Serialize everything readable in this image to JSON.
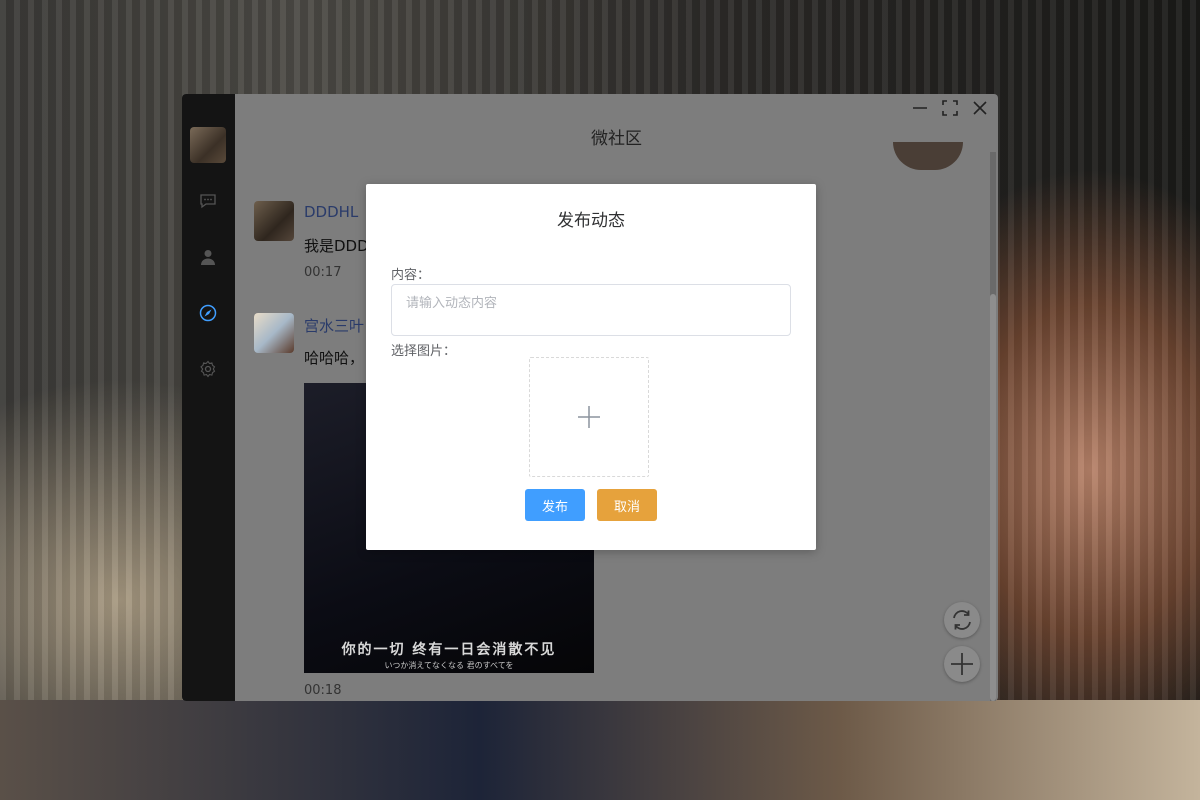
{
  "window": {
    "title": "微社区"
  },
  "sidebar": {
    "icons": [
      "chat-icon",
      "user-icon",
      "compass-icon",
      "gear-icon"
    ]
  },
  "posts": [
    {
      "name": "DDDHL",
      "text": "我是DDD",
      "time": "00:17"
    },
    {
      "name": "宫水三叶",
      "text": "哈哈哈，",
      "time": "00:18",
      "image_caption": "你的一切 终有一日会消散不见",
      "image_subcaption": "いつか消えてなくなる 君のすべてを"
    }
  ],
  "fabs": [
    "refresh-icon",
    "add-icon"
  ],
  "modal": {
    "title": "发布动态",
    "content_label": "内容：",
    "content_placeholder": "请输入动态内容",
    "content_value": "",
    "image_label": "选择图片：",
    "publish_label": "发布",
    "cancel_label": "取消"
  },
  "colors": {
    "primary": "#409eff",
    "warning": "#e6a23c",
    "sidebar": "#141414",
    "overlay_window": "#7d7d7d"
  }
}
